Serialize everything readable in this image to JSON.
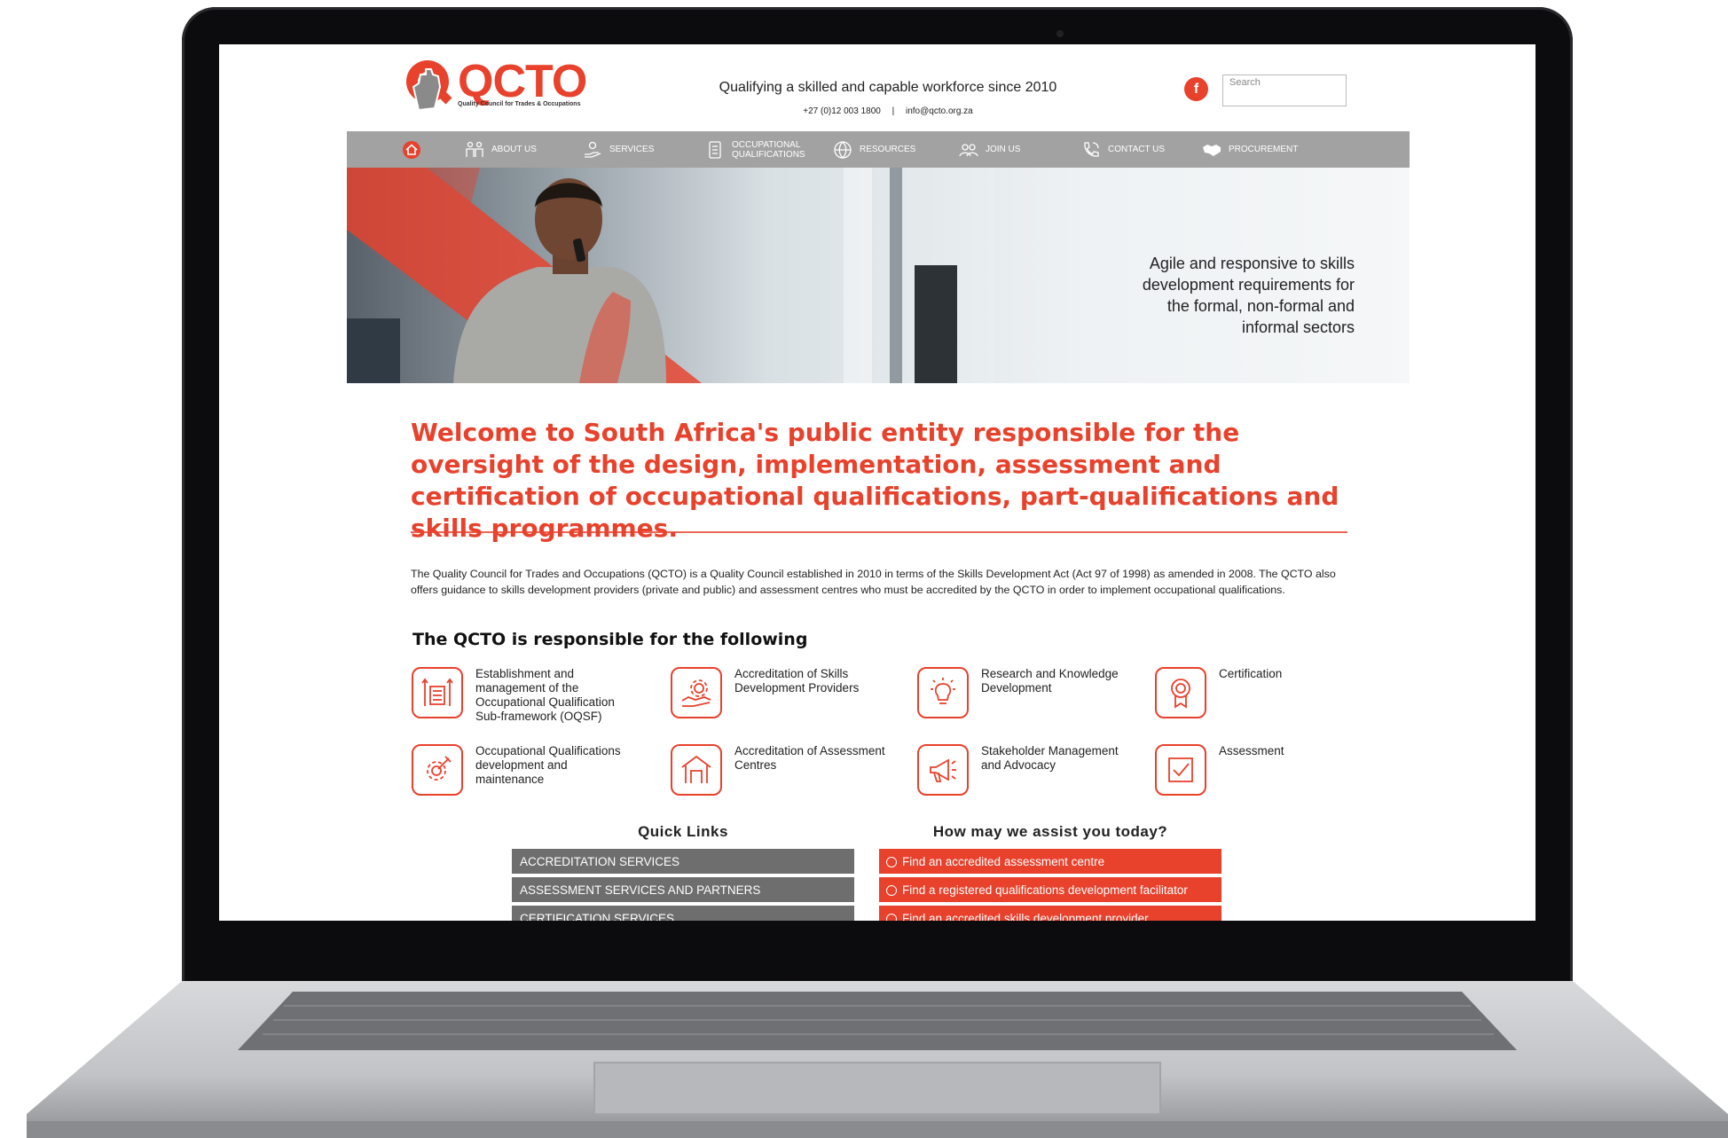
{
  "header": {
    "logo_text": "QCTO",
    "logo_sub": "Quality Council for Trades & Occupations",
    "tagline": "Qualifying a skilled and capable workforce since 2010",
    "phone": "+27 (0)12 003 1800",
    "separator": "|",
    "email": "info@qcto.org.za",
    "facebook_glyph": "f",
    "search_placeholder": "Search"
  },
  "nav": {
    "items": [
      {
        "label": "",
        "icon": "home-icon"
      },
      {
        "label": "ABOUT US",
        "icon": "people-icon"
      },
      {
        "label": "SERVICES",
        "icon": "hand-service-icon"
      },
      {
        "label": "OCCUPATIONAL QUALIFICATIONS",
        "icon": "document-icon"
      },
      {
        "label": "RESOURCES",
        "icon": "globe-icon"
      },
      {
        "label": "JOIN US",
        "icon": "group-icon"
      },
      {
        "label": "CONTACT US",
        "icon": "phone-icon"
      },
      {
        "label": "PROCUREMENT",
        "icon": "handshake-icon"
      }
    ]
  },
  "hero": {
    "text": "Agile and responsive to skills development requirements for the formal, non-formal and informal sectors"
  },
  "welcome": "Welcome to South Africa's public entity responsible for the oversight of the design, implementation, assessment and certification of occupational qualifications, part-qualifications and skills programmes.",
  "intro": "The Quality Council for Trades and Occupations (QCTO) is a Quality Council established in 2010 in terms of the Skills Development Act (Act 97 of 1998) as amended in 2008.  The QCTO also offers guidance to skills development providers (private and public) and assessment centres who must be accredited by the QCTO in order to implement occupational qualifications.",
  "responsibilities": {
    "title": "The QCTO is responsible for the following",
    "items": [
      {
        "label": "Establishment and management of the Occupational Qualification Sub-framework (OQSF)",
        "icon": "framework-icon"
      },
      {
        "label": "Accreditation of Skills Development Providers",
        "icon": "gear-hand-icon"
      },
      {
        "label": "Research and Knowledge Development",
        "icon": "lightbulb-icon"
      },
      {
        "label": "Certification",
        "icon": "award-icon"
      },
      {
        "label": "Occupational Qualifications development and maintenance",
        "icon": "wrench-gear-icon"
      },
      {
        "label": "Accreditation of Assessment Centres",
        "icon": "building-icon"
      },
      {
        "label": "Stakeholder Management and Advocacy",
        "icon": "megaphone-icon"
      },
      {
        "label": "Assessment",
        "icon": "checkbox-icon"
      }
    ]
  },
  "quick_links": {
    "title": "Quick Links",
    "items": [
      "ACCREDITATION SERVICES",
      "ASSESSMENT SERVICES AND PARTNERS",
      "CERTIFICATION SERVICES"
    ]
  },
  "assist": {
    "title": "How may we assist you today?",
    "items": [
      "Find an accredited assessment centre",
      "Find a registered qualifications development facilitator",
      "Find an accredited skills development provider"
    ]
  },
  "colors": {
    "accent": "#e8412c",
    "nav": "#a2a2a2",
    "quicklink": "#6e6e6e"
  }
}
